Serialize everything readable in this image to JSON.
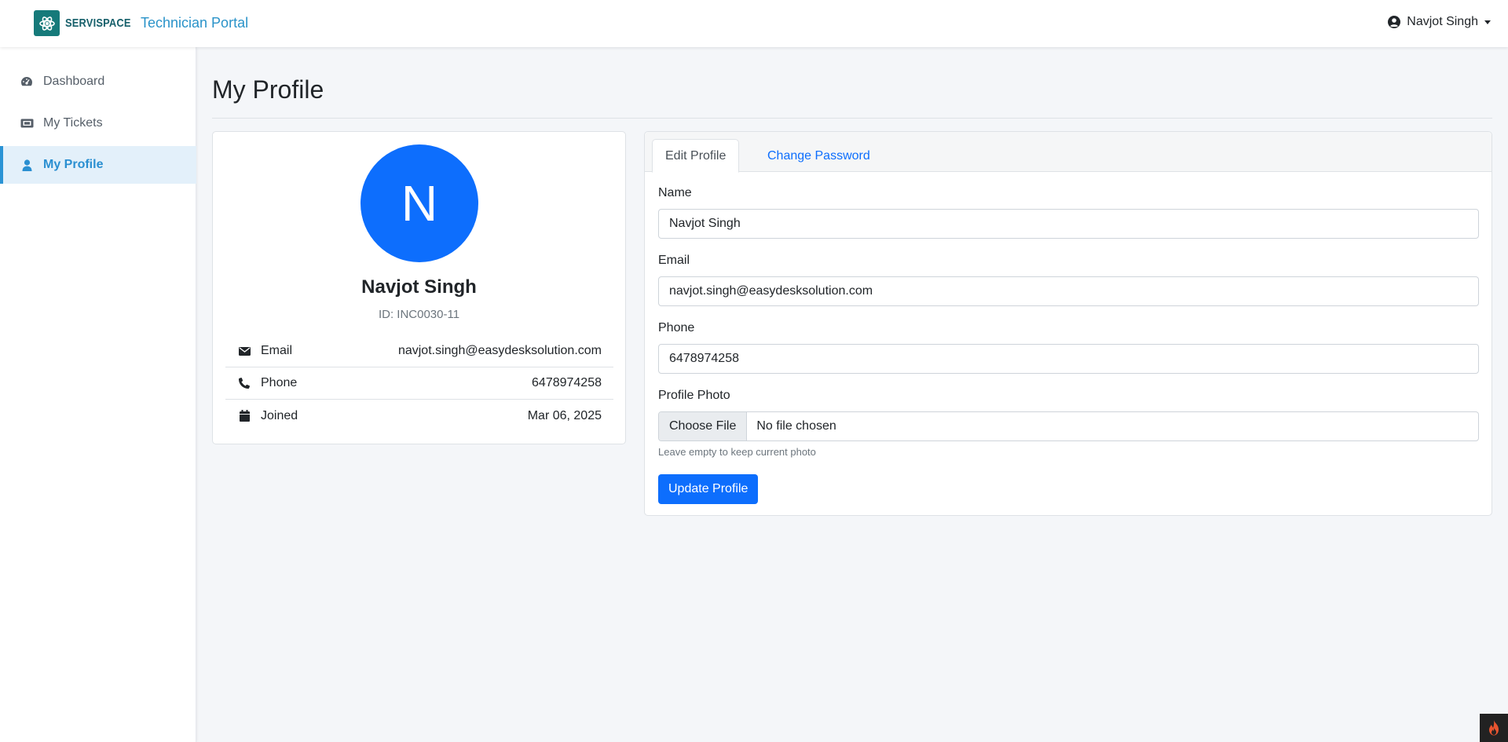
{
  "header": {
    "logo_text": "SERVISPACE",
    "portal_title": "Technician Portal",
    "user_name": "Navjot Singh"
  },
  "sidebar": {
    "items": [
      {
        "label": "Dashboard",
        "icon": "tachometer-icon",
        "active": false
      },
      {
        "label": "My Tickets",
        "icon": "ticket-icon",
        "active": false
      },
      {
        "label": "My Profile",
        "icon": "user-icon",
        "active": true
      }
    ]
  },
  "page": {
    "title": "My Profile"
  },
  "profile": {
    "avatar_initial": "N",
    "name": "Navjot Singh",
    "id_text": "ID: INC0030-11",
    "details": [
      {
        "label": "Email",
        "value": "navjot.singh@easydesksolution.com",
        "icon": "envelope-icon"
      },
      {
        "label": "Phone",
        "value": "6478974258",
        "icon": "phone-icon"
      },
      {
        "label": "Joined",
        "value": "Mar 06, 2025",
        "icon": "calendar-icon"
      }
    ]
  },
  "edit_form": {
    "tabs": [
      {
        "label": "Edit Profile",
        "active": true
      },
      {
        "label": "Change Password",
        "active": false
      }
    ],
    "name_label": "Name",
    "name_value": "Navjot Singh",
    "email_label": "Email",
    "email_value": "navjot.singh@easydesksolution.com",
    "phone_label": "Phone",
    "phone_value": "6478974258",
    "photo_label": "Profile Photo",
    "file_button": "Choose File",
    "file_status": "No file chosen",
    "photo_help": "Leave empty to keep current photo",
    "submit_label": "Update Profile"
  },
  "colors": {
    "primary": "#0d6efd",
    "brand_teal": "#167a7a",
    "portal_blue": "#2a93c9",
    "sidebar_active_bg": "#e3f0fa"
  }
}
